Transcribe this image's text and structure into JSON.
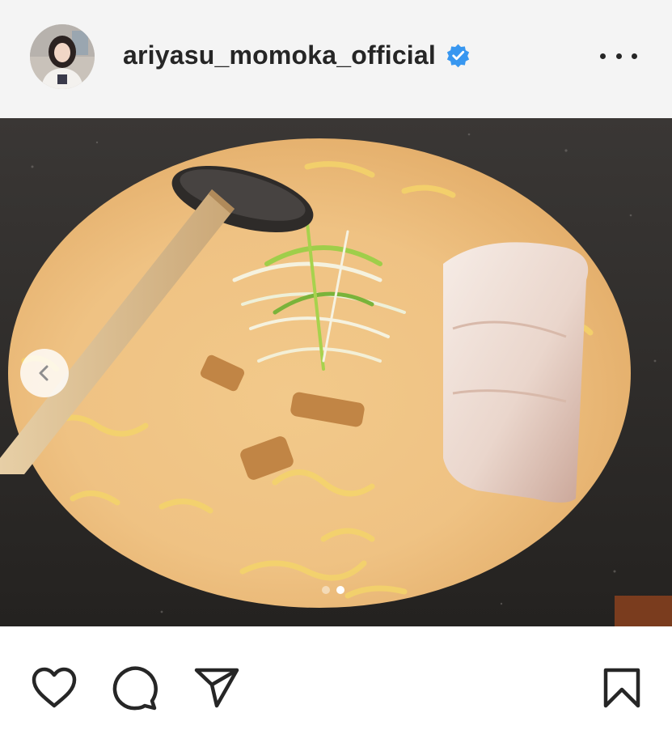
{
  "post": {
    "username": "ariyasu_momoka_official",
    "verified": true,
    "carousel": {
      "current_index": 2,
      "total": 2
    }
  },
  "icons": {
    "avatar": "avatar",
    "verified": "verified-badge-icon",
    "more": "more-options-icon",
    "prev": "chevron-left-icon",
    "like": "heart-icon",
    "comment": "comment-icon",
    "share": "paper-plane-icon",
    "save": "bookmark-icon"
  },
  "colors": {
    "verified_blue": "#3897f0",
    "text": "#262626",
    "header_bg": "#f4f4f4"
  }
}
